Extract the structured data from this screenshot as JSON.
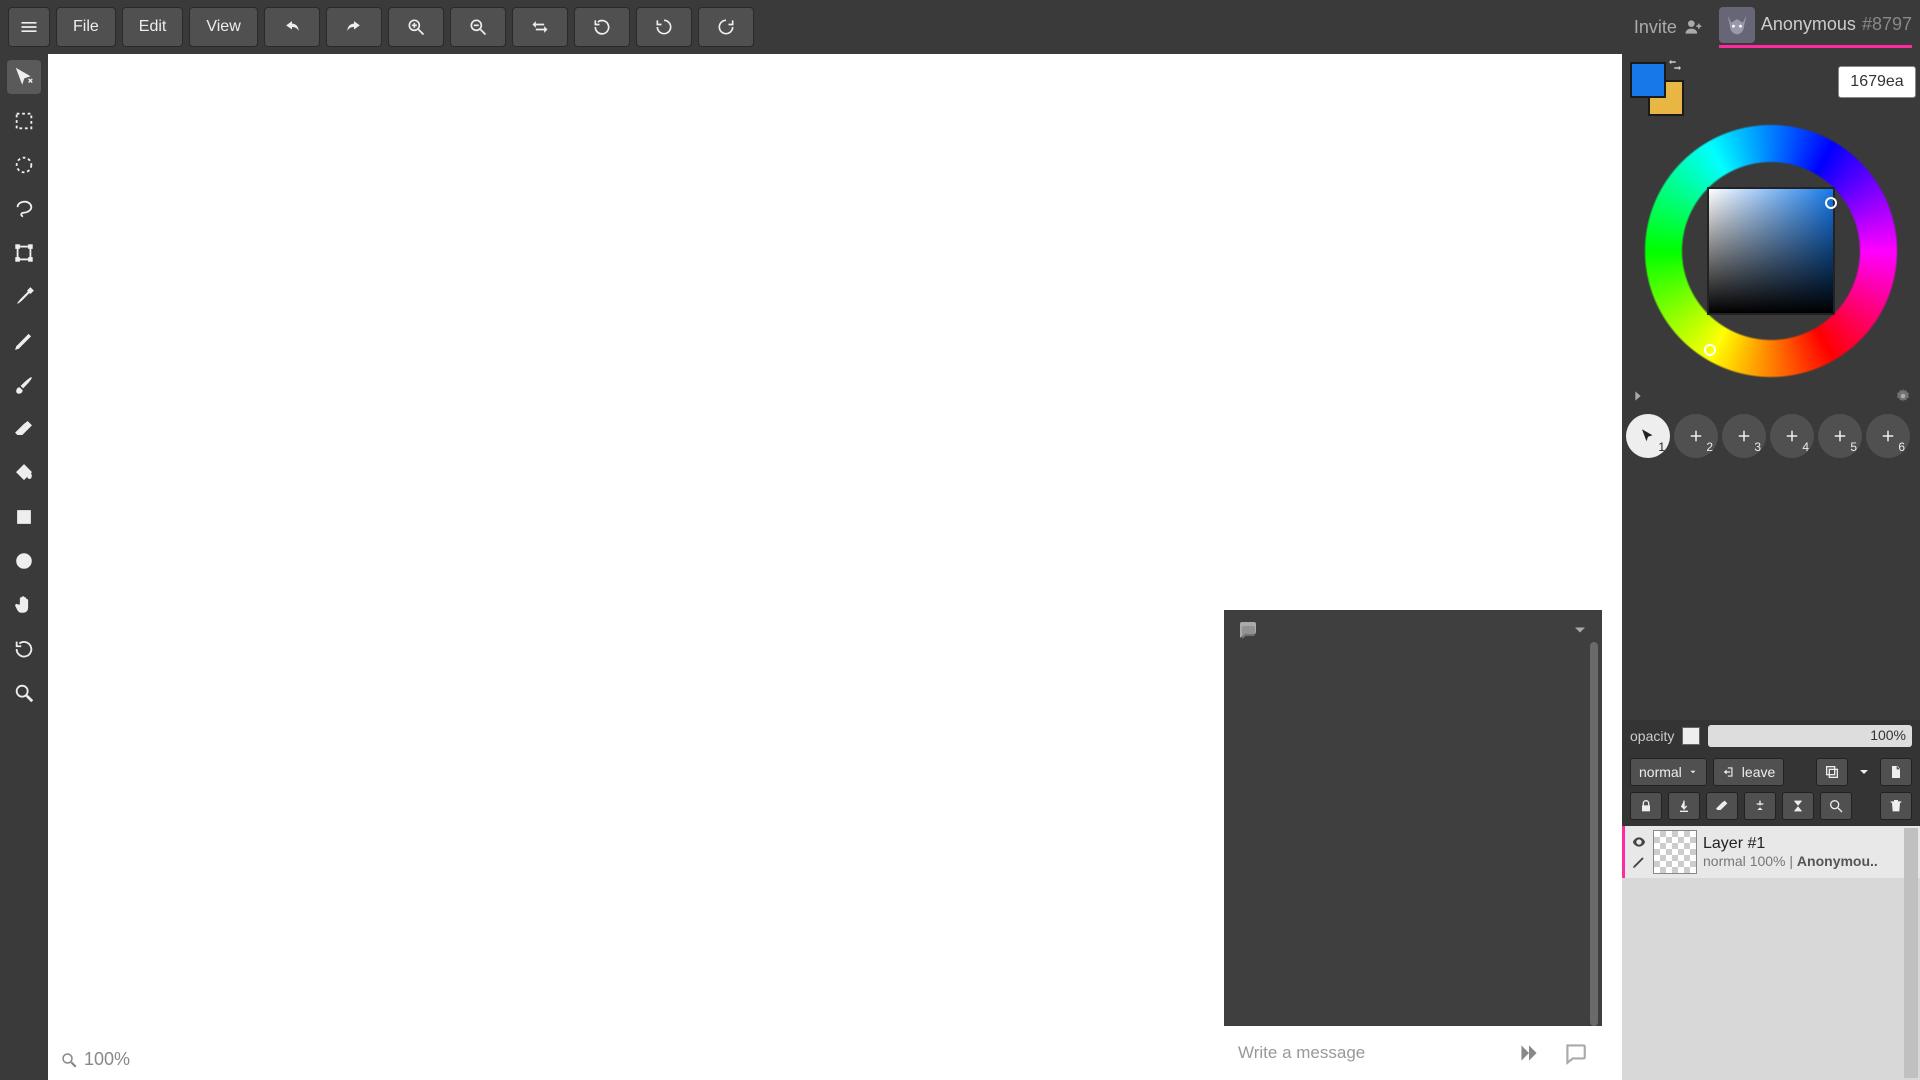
{
  "topbar": {
    "menu_label": "Menu",
    "file": "File",
    "edit": "Edit",
    "view": "View",
    "invite": "Invite"
  },
  "user": {
    "name": "Anonymous",
    "id": "#8797"
  },
  "zoom": "100%",
  "chat": {
    "placeholder": "Write a message"
  },
  "color": {
    "hex": "1679ea",
    "foreground": "#1679ea",
    "background": "#e8b642"
  },
  "brush_slots": [
    "1",
    "2",
    "3",
    "4",
    "5",
    "6"
  ],
  "opacity": {
    "label": "opacity",
    "value": "100%"
  },
  "blend_mode": "normal",
  "leave_label": "leave",
  "layers": [
    {
      "name": "Layer #1",
      "meta_mode": "normal",
      "meta_opacity": "100%",
      "owner": "Anonymou.."
    }
  ]
}
